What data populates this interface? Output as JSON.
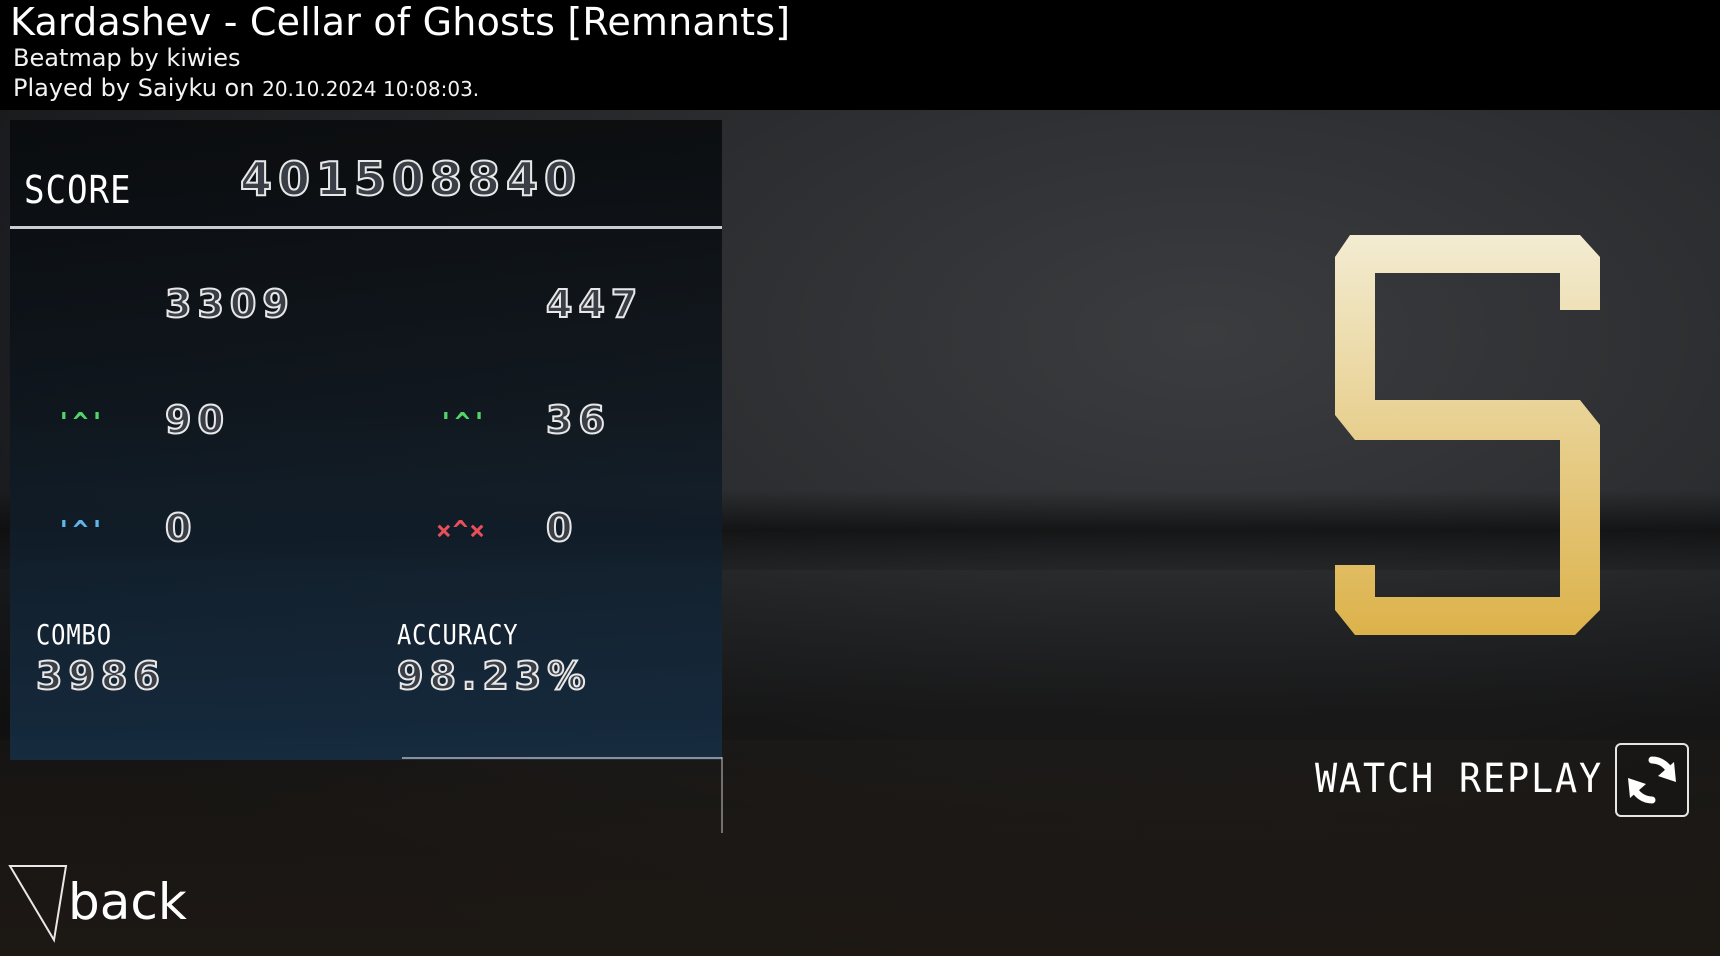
{
  "header": {
    "title": "Kardashev - Cellar of Ghosts [Remnants]",
    "beatmap_line": "Beatmap by kiwies",
    "played_prefix": "Played by Saiyku on",
    "played_date": "20.10.2024 10:08:03."
  },
  "panel": {
    "score_label": "SCORE",
    "score_value": "401508840",
    "hits": {
      "great": "3309",
      "geki": "447",
      "good": "90",
      "katu": "36",
      "meh": "0",
      "miss": "0"
    },
    "judgement_icons": {
      "good": "'^'",
      "katu": "'^'",
      "meh": "'^'",
      "miss": "×^×"
    },
    "combo_label": "COMBO",
    "combo_value": "3986",
    "accuracy_label": "ACCURACY",
    "accuracy_value": "98.23%"
  },
  "grade": "S",
  "colors": {
    "grade_top": "#f3ecd2",
    "grade_bottom": "#dcb24a",
    "judge_green": "#54d36b",
    "judge_blue": "#5fb6e8",
    "judge_red": "#e84f58"
  },
  "replay": {
    "label": "WATCH REPLAY",
    "icon": "replay-icon"
  },
  "back": {
    "label": "back"
  }
}
